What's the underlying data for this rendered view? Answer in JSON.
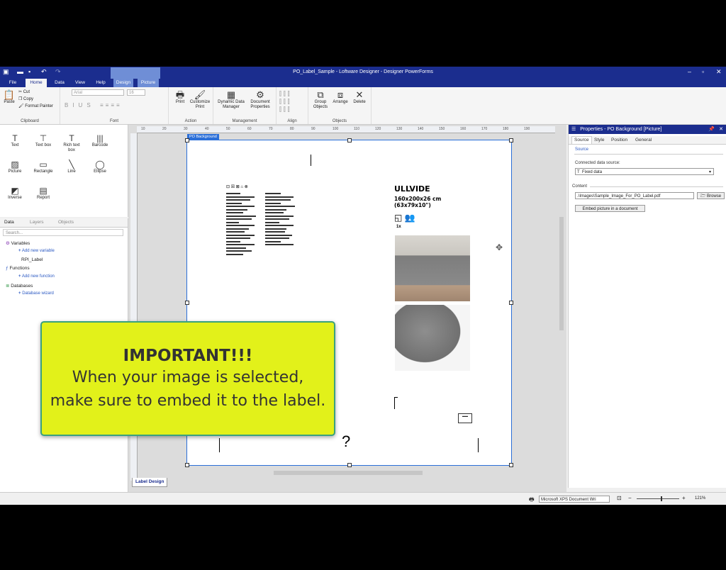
{
  "window": {
    "title": "PO_Label_Sample - Loftware Designer - Designer PowerForms"
  },
  "menu": {
    "tabs": [
      "File",
      "Home",
      "Data",
      "View",
      "Help"
    ],
    "context_tabs": [
      "Design",
      "Picture"
    ]
  },
  "ribbon": {
    "clipboard": {
      "paste": "Paste",
      "cut": "Cut",
      "copy": "Copy",
      "format_painter": "Format Painter",
      "label": "Clipboard"
    },
    "font": {
      "name": "Arial",
      "size": "16",
      "label": "Font"
    },
    "action": {
      "print": "Print",
      "customize_print": "Customize Print",
      "label": "Action"
    },
    "management": {
      "dynamic_data": "Dynamic Data Manager",
      "document_properties": "Document Properties",
      "label": "Management"
    },
    "align": {
      "label": "Align"
    },
    "objects": {
      "group": "Group Objects",
      "arrange": "Arrange",
      "delete": "Delete",
      "label": "Objects"
    }
  },
  "toolbox": [
    "Text",
    "Text box",
    "Rich text box",
    "Barcode",
    "Picture",
    "Rectangle",
    "Line",
    "Ellipse",
    "Inverse",
    "Report"
  ],
  "data_panel": {
    "tabs": [
      "Data",
      "Layers",
      "Objects"
    ],
    "search_placeholder": "Search...",
    "tree": {
      "variables": "Variables",
      "add_variable": "Add new variable",
      "rpi_label": "RPI_Label",
      "functions": "Functions",
      "add_function": "Add new function",
      "databases": "Databases",
      "database_wizard": "Database wizard"
    }
  },
  "canvas": {
    "selection_tag": "PO Background",
    "ruler_marks": [
      "10",
      "20",
      "30",
      "40",
      "50",
      "60",
      "70",
      "80",
      "90",
      "100",
      "110",
      "120",
      "130",
      "140",
      "150",
      "160",
      "170",
      "180",
      "190"
    ],
    "bottom_tab": "Label Design",
    "label_content": {
      "product_name": "ULLVIDE",
      "dimensions": "160x200x26 cm\n(63x79x10\")",
      "quantity": "1x",
      "question_mark": "?"
    }
  },
  "properties": {
    "title": "Properties - PO Background [Picture]",
    "tabs": [
      "Source",
      "Style",
      "Position",
      "General"
    ],
    "section": "Source",
    "connected_source_label": "Connected data source:",
    "connected_source_value": "Fixed data",
    "content_label": "Content",
    "content_value": ".\\Images\\Sample_Image_For_PO_Label.pdf",
    "browse_button": "Browse",
    "embed_button": "Embed picture in a document"
  },
  "statusbar": {
    "printer": "Microsoft XPS Document Wri",
    "zoom": "121%"
  },
  "callout": {
    "heading": "IMPORTANT!!!",
    "line1": "When your image is selected,",
    "line2": "make sure to embed it to the label."
  },
  "colors": {
    "titlebar": "#1b2d8e",
    "accent": "#2b6fd8",
    "callout_bg": "#e2f11a",
    "callout_border": "#3aa17e"
  }
}
